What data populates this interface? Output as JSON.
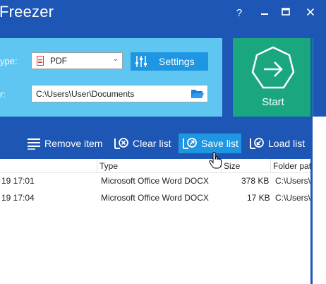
{
  "title": "Freezer",
  "window_controls": {
    "help": "?",
    "minimize": "—",
    "maximize": "■",
    "close": "✕"
  },
  "settings": {
    "type_label": "ype:",
    "format_value": "PDF",
    "settings_button": "Settings",
    "folder_label": "r:",
    "folder_value": "C:\\Users\\User\\Documents"
  },
  "start_label": "Start",
  "toolbar": {
    "remove": "Remove item",
    "clear": "Clear list",
    "save": "Save list",
    "load": "Load list"
  },
  "columns": {
    "date": "",
    "type": "Type",
    "size": "Size",
    "folder": "Folder pat"
  },
  "rows": [
    {
      "date": "19 17:01",
      "type": "Microsoft Office Word DOCX",
      "size": "378 KB",
      "folder": "C:\\Users\\"
    },
    {
      "date": "19 17:04",
      "type": "Microsoft Office Word DOCX",
      "size": "17 KB",
      "folder": "C:\\Users\\"
    }
  ],
  "colors": {
    "title_bar": "#1d56b4",
    "panel": "#5ec6f1",
    "start": "#1aa780",
    "accent": "#1e96e2"
  },
  "icons": {
    "format": "pdf-icon",
    "settings": "sliders-icon",
    "folder": "folder-open-icon",
    "start": "arrow-right-circle-icon",
    "remove": "list-remove-icon",
    "clear": "clear-list-icon",
    "save": "save-list-icon",
    "load": "load-list-icon"
  }
}
